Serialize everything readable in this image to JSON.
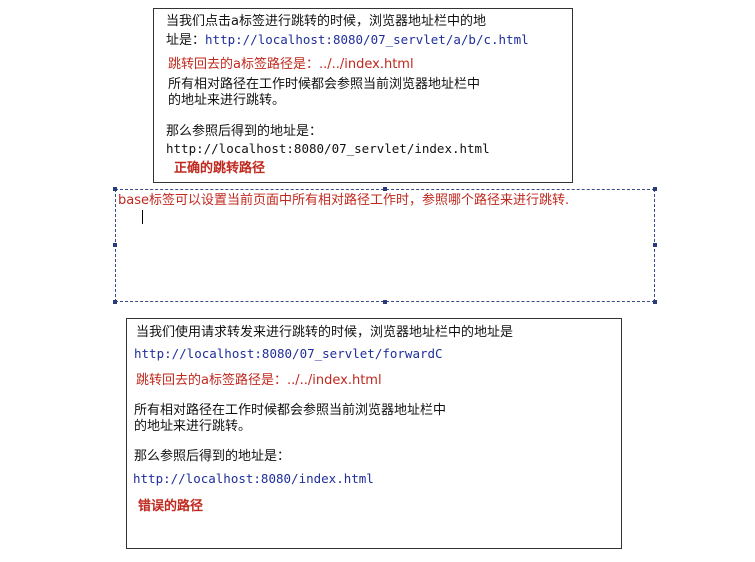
{
  "top_box": {
    "line1": "当我们点击a标签进行跳转的时候，浏览器地址栏中的地",
    "line2_prefix": "址是：",
    "line2_url": "http://localhost:8080/07_servlet/a/b/c.html",
    "jump_path": "跳转回去的a标签路径是：../../index.html",
    "note_line1": "所有相对路径在工作时候都会参照当前浏览器地址栏中",
    "note_line2": "的地址来进行跳转。",
    "result_label": "那么参照后得到的地址是：",
    "result_url": "http://localhost:8080/07_servlet/index.html",
    "verdict": "正确的跳转路径"
  },
  "text_frame": {
    "content": "base标签可以设置当前页面中所有相对路径工作时，参照哪个路径来进行跳转."
  },
  "bottom_box": {
    "line1": "当我们使用请求转发来进行跳转的时候，浏览器地址栏中的地址是",
    "url": "http://localhost:8080/07_servlet/forwardC",
    "jump_path": "跳转回去的a标签路径是：../../index.html",
    "note_line1": "所有相对路径在工作时候都会参照当前浏览器地址栏中",
    "note_line2": "的地址来进行跳转。",
    "result_label": "那么参照后得到的地址是：",
    "result_url": "http://localhost:8080/index.html",
    "verdict": "错误的路径"
  }
}
